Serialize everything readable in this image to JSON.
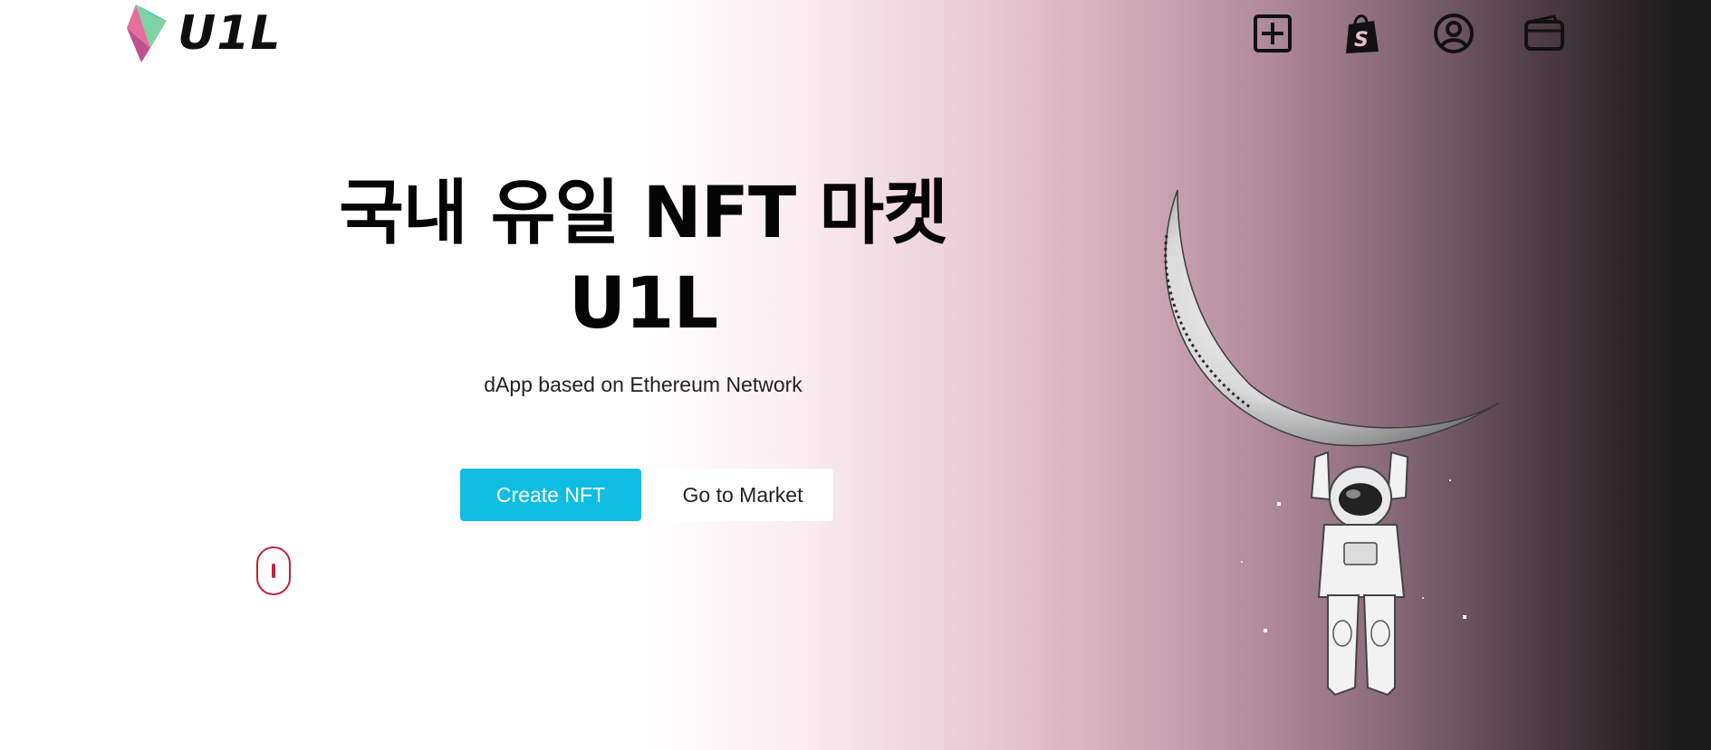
{
  "header": {
    "logo_text": "U1L",
    "nav_icons": [
      "plus-square-icon",
      "shopify-bag-icon",
      "user-circle-icon",
      "wallet-icon"
    ]
  },
  "hero": {
    "title": "국내 유일 NFT 마켓",
    "subtitle": "U1L",
    "tagline": "dApp based on Ethereum Network",
    "buttons": {
      "create": "Create NFT",
      "market": "Go to Market"
    }
  },
  "colors": {
    "accent": "#0fbde3",
    "scroll_indicator": "#c0223f",
    "text": "#050505"
  },
  "illustration": "astronaut-hanging-from-crescent-moon"
}
